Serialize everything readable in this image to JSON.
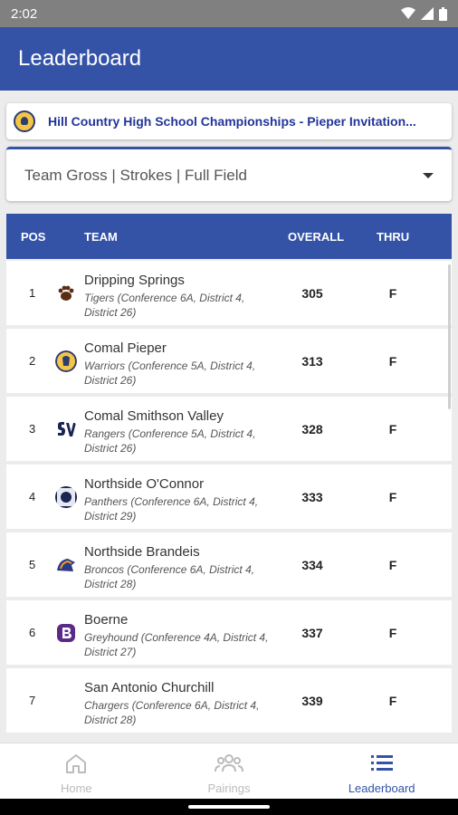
{
  "status": {
    "time": "2:02"
  },
  "app_bar": {
    "title": "Leaderboard"
  },
  "event": {
    "name": "Hill Country High School Championships - Pieper Invitation..."
  },
  "filter": {
    "label": "Team Gross | Strokes | Full Field"
  },
  "table": {
    "headers": {
      "pos": "POS",
      "team": "TEAM",
      "overall": "OVERALL",
      "thru": "THRU"
    },
    "rows": [
      {
        "pos": "1",
        "name": "Dripping Springs",
        "sub": "Tigers (Conference 6A, District 4, District 26)",
        "overall": "305",
        "thru": "F"
      },
      {
        "pos": "2",
        "name": "Comal Pieper",
        "sub": "Warriors (Conference 5A, District 4, District 26)",
        "overall": "313",
        "thru": "F"
      },
      {
        "pos": "3",
        "name": "Comal Smithson Valley",
        "sub": "Rangers (Conference 5A, District 4, District 26)",
        "overall": "328",
        "thru": "F"
      },
      {
        "pos": "4",
        "name": "Northside O'Connor",
        "sub": "Panthers (Conference 6A, District 4, District 29)",
        "overall": "333",
        "thru": "F"
      },
      {
        "pos": "5",
        "name": "Northside Brandeis",
        "sub": "Broncos (Conference 6A, District 4, District 28)",
        "overall": "334",
        "thru": "F"
      },
      {
        "pos": "6",
        "name": "Boerne",
        "sub": "Greyhound (Conference 4A, District 4, District 27)",
        "overall": "337",
        "thru": "F"
      },
      {
        "pos": "7",
        "name": "San Antonio Churchill",
        "sub": "Chargers (Conference 6A, District 4, District 28)",
        "overall": "339",
        "thru": "F"
      }
    ]
  },
  "nav": {
    "home": "Home",
    "pairings": "Pairings",
    "leaderboard": "Leaderboard"
  },
  "colors": {
    "primary": "#3453a7",
    "event_text": "#22349a"
  }
}
